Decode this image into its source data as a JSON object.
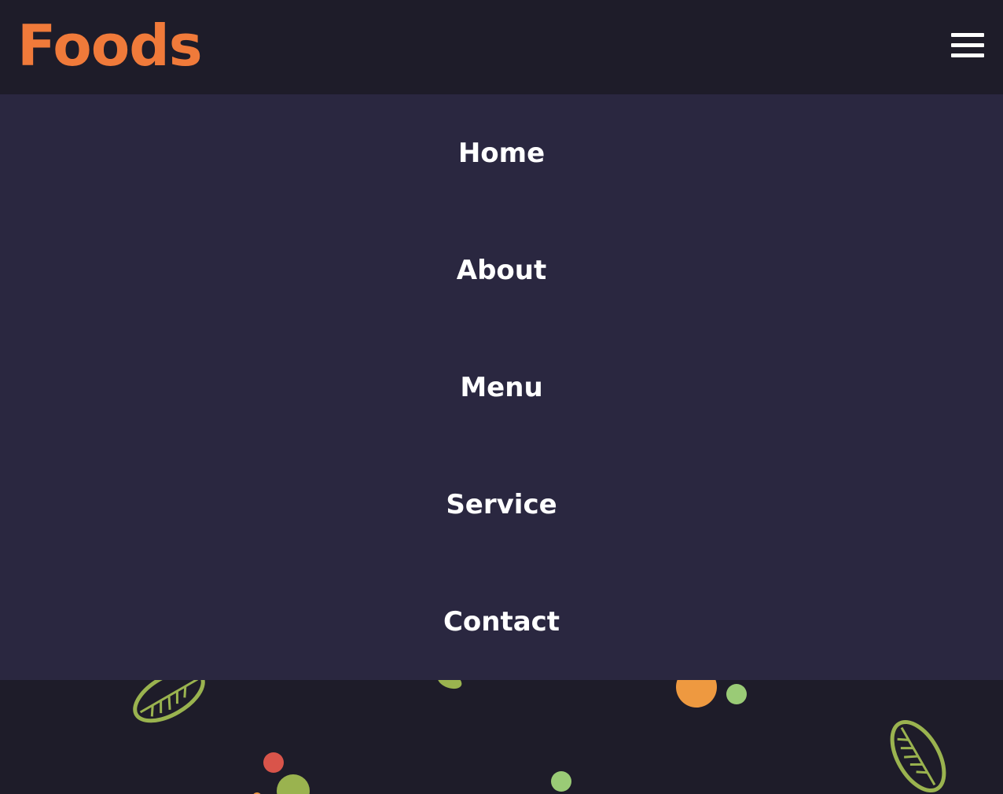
{
  "header": {
    "logo_text": "Foods",
    "menu_icon": "hamburger-menu-icon"
  },
  "nav": {
    "items": [
      {
        "label": "Home"
      },
      {
        "label": "About"
      },
      {
        "label": "Menu"
      },
      {
        "label": "Service"
      },
      {
        "label": "Contact"
      }
    ]
  },
  "colors": {
    "logo_orange": "#f07a3a",
    "header_bg": "#1e1c29",
    "nav_panel_bg": "#2a2740",
    "nav_text": "#ffffff",
    "leaf_green": "#9ab34f",
    "dot_orange": "#ee9940",
    "dot_green": "#9acb76",
    "dot_red": "#d9544a"
  },
  "decorations": {
    "icons": [
      "leaf-icon",
      "orange-dot",
      "green-dot",
      "red-dot"
    ]
  }
}
